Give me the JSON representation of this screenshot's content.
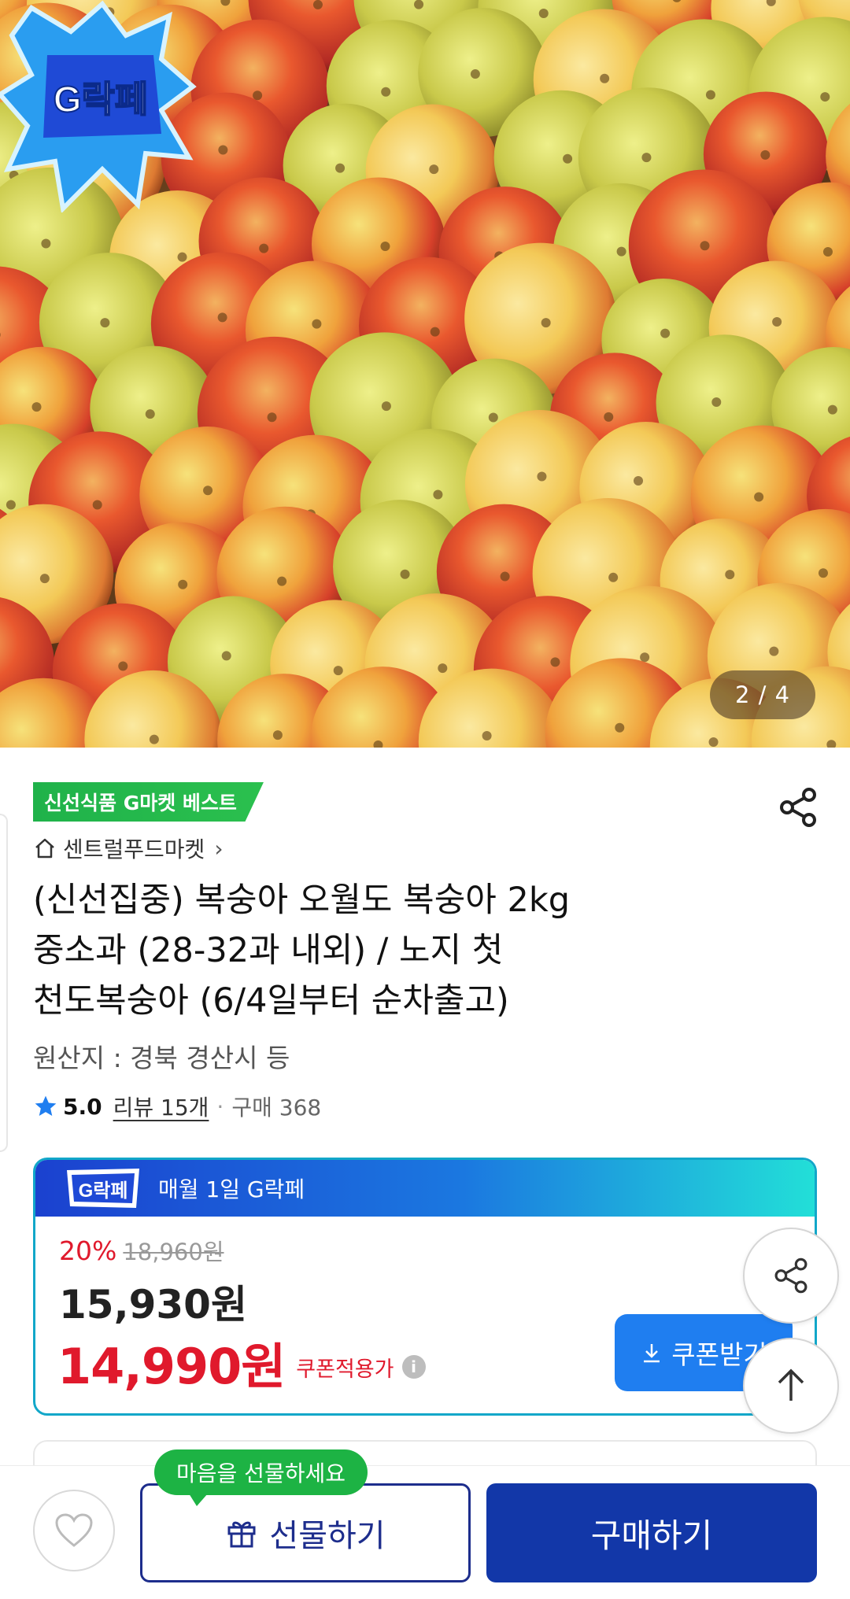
{
  "hero": {
    "page_indicator": "2 / 4",
    "badge_text": "G락페",
    "image_subject": "peaches"
  },
  "product": {
    "best_badge": "신선식품 G마켓 베스트",
    "seller": "센트럴푸드마켓",
    "title_lines": [
      "(신선집중) 복숭아 오월도 복숭아 2kg",
      "중소과 (28-32과 내외) / 노지 첫",
      "천도복숭아 (6/4일부터 순차출고)"
    ],
    "origin": "원산지 : 경북 경산시 등",
    "rating": "5.0",
    "review_label": "리뷰 15개",
    "purchase_label": "구매 368"
  },
  "price_card": {
    "promo_text": "매월 1일 G락페",
    "promo_logo_text": "G락페",
    "discount_rate": "20%",
    "original_price": "18,960원",
    "sale_price": "15,930원",
    "coupon_price": "14,990원",
    "coupon_label": "쿠폰적용가",
    "coupon_button": "쿠폰받기"
  },
  "bottom": {
    "gift_tooltip": "마음을 선물하세요",
    "gift_button": "선물하기",
    "buy_button": "구매하기"
  },
  "colors": {
    "accent_red": "#e0192c",
    "brand_blue": "#1237a8",
    "coupon_blue": "#1f7ef0",
    "best_green": "#1fb24a"
  },
  "icons": [
    "share-icon",
    "home-icon",
    "chevron-right-icon",
    "star-icon",
    "info-icon",
    "download-icon",
    "arrow-up-icon",
    "heart-icon",
    "gift-icon"
  ]
}
